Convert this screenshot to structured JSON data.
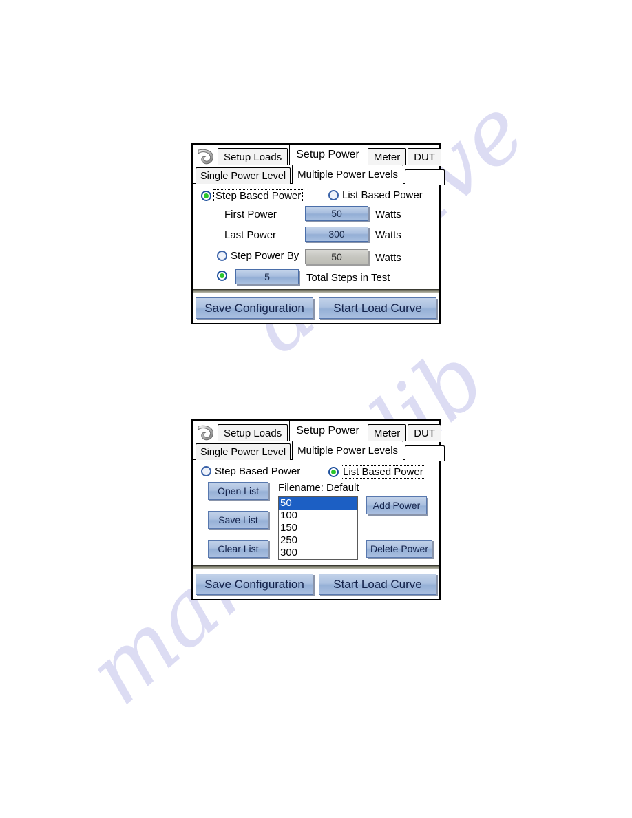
{
  "watermark": {
    "line1": "archive",
    "line2": "manualslib"
  },
  "icons": {
    "back": "back-arrow-icon"
  },
  "tabs": {
    "items": [
      {
        "label": "Setup Loads",
        "active": false
      },
      {
        "label": "Setup Power",
        "active": true
      },
      {
        "label": "Meter",
        "active": false
      },
      {
        "label": "DUT",
        "active": false
      }
    ]
  },
  "subtabs": {
    "items": [
      {
        "label": "Single Power Level",
        "active": false
      },
      {
        "label": "Multiple Power Levels",
        "active": true
      }
    ]
  },
  "panel_step": {
    "mode_radios": {
      "step_based": {
        "label": "Step Based Power",
        "selected": true
      },
      "list_based": {
        "label": "List Based Power",
        "selected": false
      }
    },
    "first_power": {
      "label": "First Power",
      "value": "50",
      "unit": "Watts"
    },
    "last_power": {
      "label": "Last Power",
      "value": "300",
      "unit": "Watts"
    },
    "step_power_by": {
      "label": "Step Power By",
      "value": "50",
      "unit": "Watts",
      "selected": false,
      "disabled": true
    },
    "total_steps": {
      "label": "Total Steps in Test",
      "value": "5",
      "selected": true
    }
  },
  "panel_list": {
    "mode_radios": {
      "step_based": {
        "label": "Step Based Power",
        "selected": false
      },
      "list_based": {
        "label": "List Based Power",
        "selected": true
      }
    },
    "filename": "Filename: Default",
    "left_buttons": [
      {
        "label": "Open List"
      },
      {
        "label": "Save List"
      },
      {
        "label": "Clear List"
      }
    ],
    "right_buttons": [
      {
        "label": "Add Power"
      },
      {
        "label": "Delete Power"
      }
    ],
    "power_list": [
      {
        "value": "50",
        "selected": true
      },
      {
        "value": "100",
        "selected": false
      },
      {
        "value": "150",
        "selected": false
      },
      {
        "value": "250",
        "selected": false
      },
      {
        "value": "300",
        "selected": false
      }
    ]
  },
  "actions": {
    "save_configuration": "Save Configuration",
    "start_load_curve": "Start Load Curve"
  },
  "colors": {
    "accent_blue": "#1c5fc4",
    "button_face": "#acc1e0",
    "radio_on_dot": "#2cc62c",
    "disabled_face": "#c6c6c0"
  }
}
